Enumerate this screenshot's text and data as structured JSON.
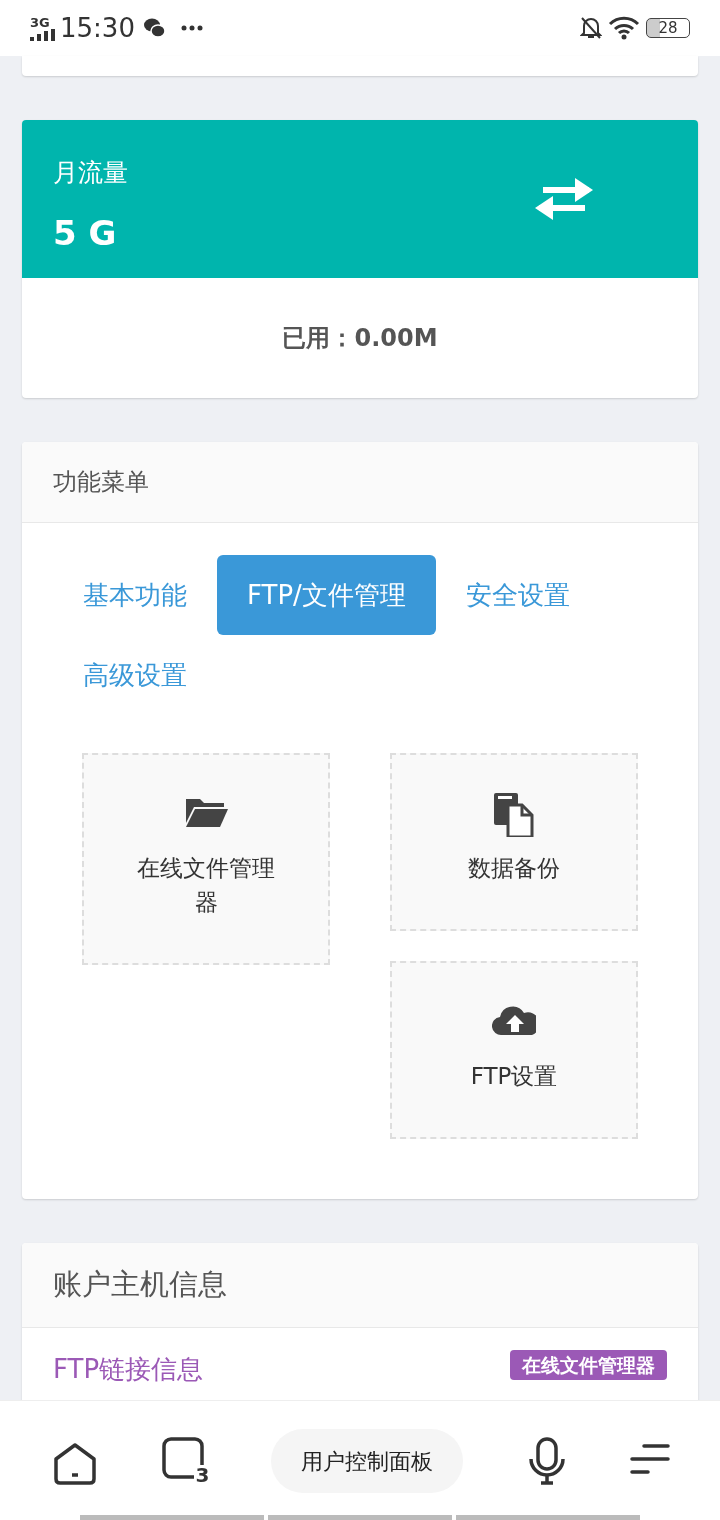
{
  "status_bar": {
    "network": "3G",
    "time": "15:30",
    "battery": "28"
  },
  "traffic_card": {
    "title": "月流量",
    "value": "5 G",
    "used": "已用：0.00M"
  },
  "menu": {
    "title": "功能菜单",
    "tabs": [
      {
        "label": "基本功能",
        "selected": false
      },
      {
        "label": "FTP/文件管理",
        "selected": true
      },
      {
        "label": "安全设置",
        "selected": false
      },
      {
        "label": "高级设置",
        "selected": false
      }
    ],
    "tiles": [
      {
        "label": "在线文件管理器",
        "kind": "folder"
      },
      {
        "label": "数据备份",
        "kind": "copy"
      },
      {
        "label": "FTP设置",
        "kind": "cloud-upload"
      }
    ]
  },
  "account": {
    "title": "账户主机信息",
    "section": "FTP链接信息",
    "badge": "在线文件管理器"
  },
  "bottom_nav": {
    "tab_count": "3",
    "center": "用户控制面板"
  }
}
